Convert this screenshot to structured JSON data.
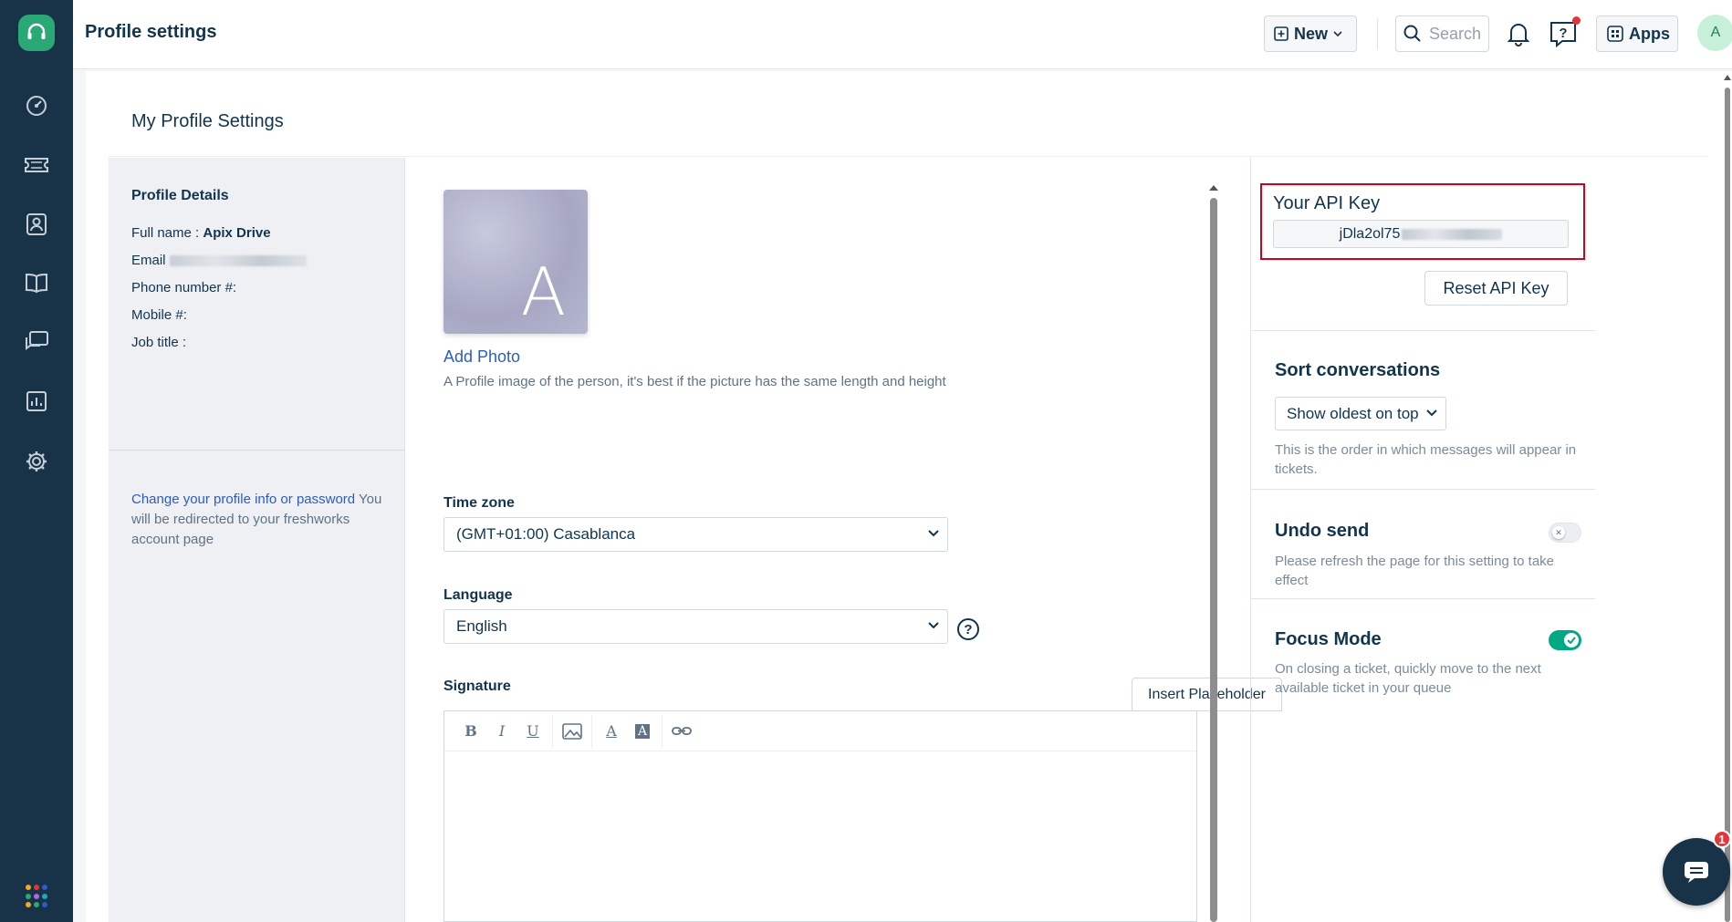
{
  "header": {
    "title": "Profile settings",
    "new_label": "New",
    "search_placeholder": "Search",
    "apps_label": "Apps",
    "avatar_initial": "A"
  },
  "page": {
    "section_title": "My Profile Settings"
  },
  "profile_details": {
    "heading": "Profile Details",
    "full_name_label": "Full name :",
    "full_name_value": "Apix Drive",
    "email_label": "Email",
    "phone_label": "Phone number #:",
    "mobile_label": "Mobile #:",
    "job_title_label": "Job title :",
    "change_link": "Change your profile info or password",
    "change_note": " You will be redirected to your freshworks account page"
  },
  "photo": {
    "initial": "A",
    "add_label": "Add Photo",
    "hint": "A Profile image of the person, it's best if the picture has the same length and height"
  },
  "timezone": {
    "label": "Time zone",
    "value": "(GMT+01:00) Casablanca"
  },
  "language": {
    "label": "Language",
    "value": "English",
    "help_symbol": "?"
  },
  "signature": {
    "label": "Signature",
    "insert_placeholder_label": "Insert Placeholder",
    "toolbar": {
      "bold": "B",
      "italic": "I",
      "underline": "U",
      "font_color": "A",
      "bg_color": "A"
    }
  },
  "api": {
    "label": "Your API Key",
    "value_visible": "jDla2ol75",
    "reset_label": "Reset API Key"
  },
  "sort": {
    "title": "Sort conversations",
    "value": "Show oldest on top",
    "description": "This is the order in which messages will appear in tickets."
  },
  "undo": {
    "title": "Undo send",
    "description": "Please refresh the page for this setting to take effect",
    "enabled": false
  },
  "focus": {
    "title": "Focus Mode",
    "description": "On closing a ticket, quickly move to the next available ticket in your queue",
    "enabled": true
  },
  "chat": {
    "badge": "1"
  },
  "colors": {
    "sidebar": "#183247",
    "brand": "#2aa876",
    "link": "#2c5cc5",
    "highlight": "#d0021b",
    "toggle_on": "#00a886"
  },
  "icons": {
    "sidebar": [
      "dashboard-icon",
      "tickets-icon",
      "contacts-icon",
      "knowledge-base-icon",
      "forums-icon",
      "reports-icon",
      "admin-gear-icon"
    ]
  }
}
